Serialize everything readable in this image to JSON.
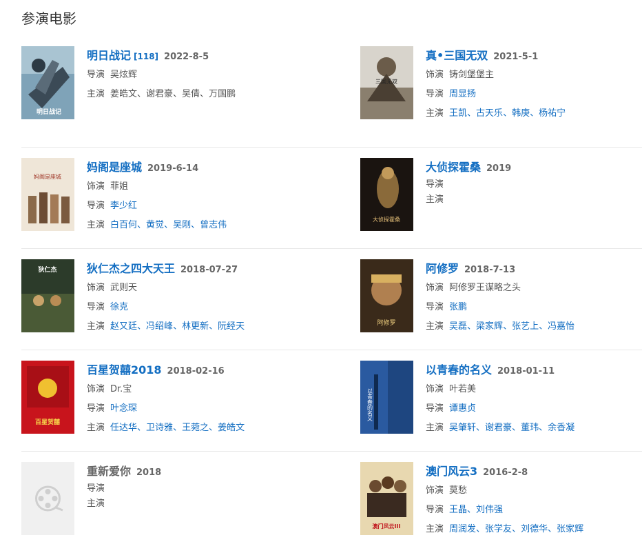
{
  "section_title": "参演电影",
  "labels": {
    "role": "饰演",
    "director": "导演",
    "cast": "主演"
  },
  "films": [
    {
      "title": "明日战记",
      "sup": "[118]",
      "year": "2022-8-5",
      "director": [
        "吴炫辉"
      ],
      "director_link": false,
      "cast": [
        "姜皓文",
        "谢君豪",
        "吴倩",
        "万国鹏"
      ],
      "cast_link": false,
      "poster": "poster-1"
    },
    {
      "title": "真•三国无双",
      "year": "2021-5-1",
      "role": "铸剑堡堡主",
      "director": [
        "周显扬"
      ],
      "director_link": true,
      "cast": [
        "王凯",
        "古天乐",
        "韩庚",
        "杨祐宁"
      ],
      "cast_link": true
    },
    {
      "title": "妈阁是座城",
      "year": "2019-6-14",
      "role": "菲姐",
      "director": [
        "李少红"
      ],
      "director_link": true,
      "cast": [
        "白百何",
        "黄觉",
        "吴刚",
        "曾志伟"
      ],
      "cast_link": true
    },
    {
      "title": "大侦探霍桑",
      "year": "2019"
    },
    {
      "title": "狄仁杰之四大天王",
      "year": "2018-07-27",
      "role": "武则天",
      "director": [
        "徐克"
      ],
      "director_link": true,
      "cast": [
        "赵又廷",
        "冯绍峰",
        "林更新",
        "阮经天"
      ],
      "cast_link": true
    },
    {
      "title": "阿修罗",
      "year": "2018-7-13",
      "role": "阿修罗王谋略之头",
      "director": [
        "张鹏"
      ],
      "director_link": true,
      "cast": [
        "吴磊",
        "梁家辉",
        "张艺上",
        "冯嘉怡"
      ],
      "cast_link": true
    },
    {
      "title": "百星贺囍2018",
      "year": "2018-02-16",
      "role": "Dr.宝",
      "director": [
        "叶念琛"
      ],
      "director_link": true,
      "cast": [
        "任达华",
        "卫诗雅",
        "王菀之",
        "姜皓文"
      ],
      "cast_link": true
    },
    {
      "title": "以青春的名义",
      "year": "2018-01-11",
      "role": "叶若美",
      "director": [
        "谭惠贞"
      ],
      "director_link": true,
      "cast": [
        "吴肇轩",
        "谢君豪",
        "董玮",
        "余香凝"
      ],
      "cast_link": true
    },
    {
      "title": "重新爱你",
      "year": "2018",
      "placeholder": true
    },
    {
      "title": "澳门风云3",
      "year": "2016-2-8",
      "role": "莫愁",
      "director": [
        "王晶",
        "刘伟强"
      ],
      "director_link": true,
      "cast": [
        "周润发",
        "张学友",
        "刘德华",
        "张家辉"
      ],
      "cast_link": true
    }
  ],
  "poster_texts": {
    "p1": "明日战记",
    "p2": "三国无双",
    "p3": "妈阁是座城",
    "p4": "大侦探霍桑",
    "p5": "狄仁杰",
    "p6": "阿修罗",
    "p7": "百星贺囍",
    "p8": "以青春的名义",
    "p10": "澳门风云III"
  },
  "colors": {
    "link": "#136ec2",
    "divider": "#e8e8e8"
  }
}
